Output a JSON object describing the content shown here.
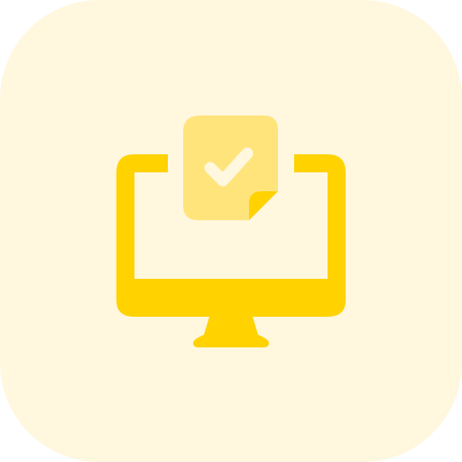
{
  "icon": {
    "name": "computer-document-check-icon",
    "parts": [
      "rounded-background",
      "monitor",
      "document",
      "checkmark"
    ]
  },
  "colors": {
    "background": "#FFF7DE",
    "monitor": "#FFD200",
    "document": "#FFE47C",
    "checkmark": "#FFF7DE"
  }
}
